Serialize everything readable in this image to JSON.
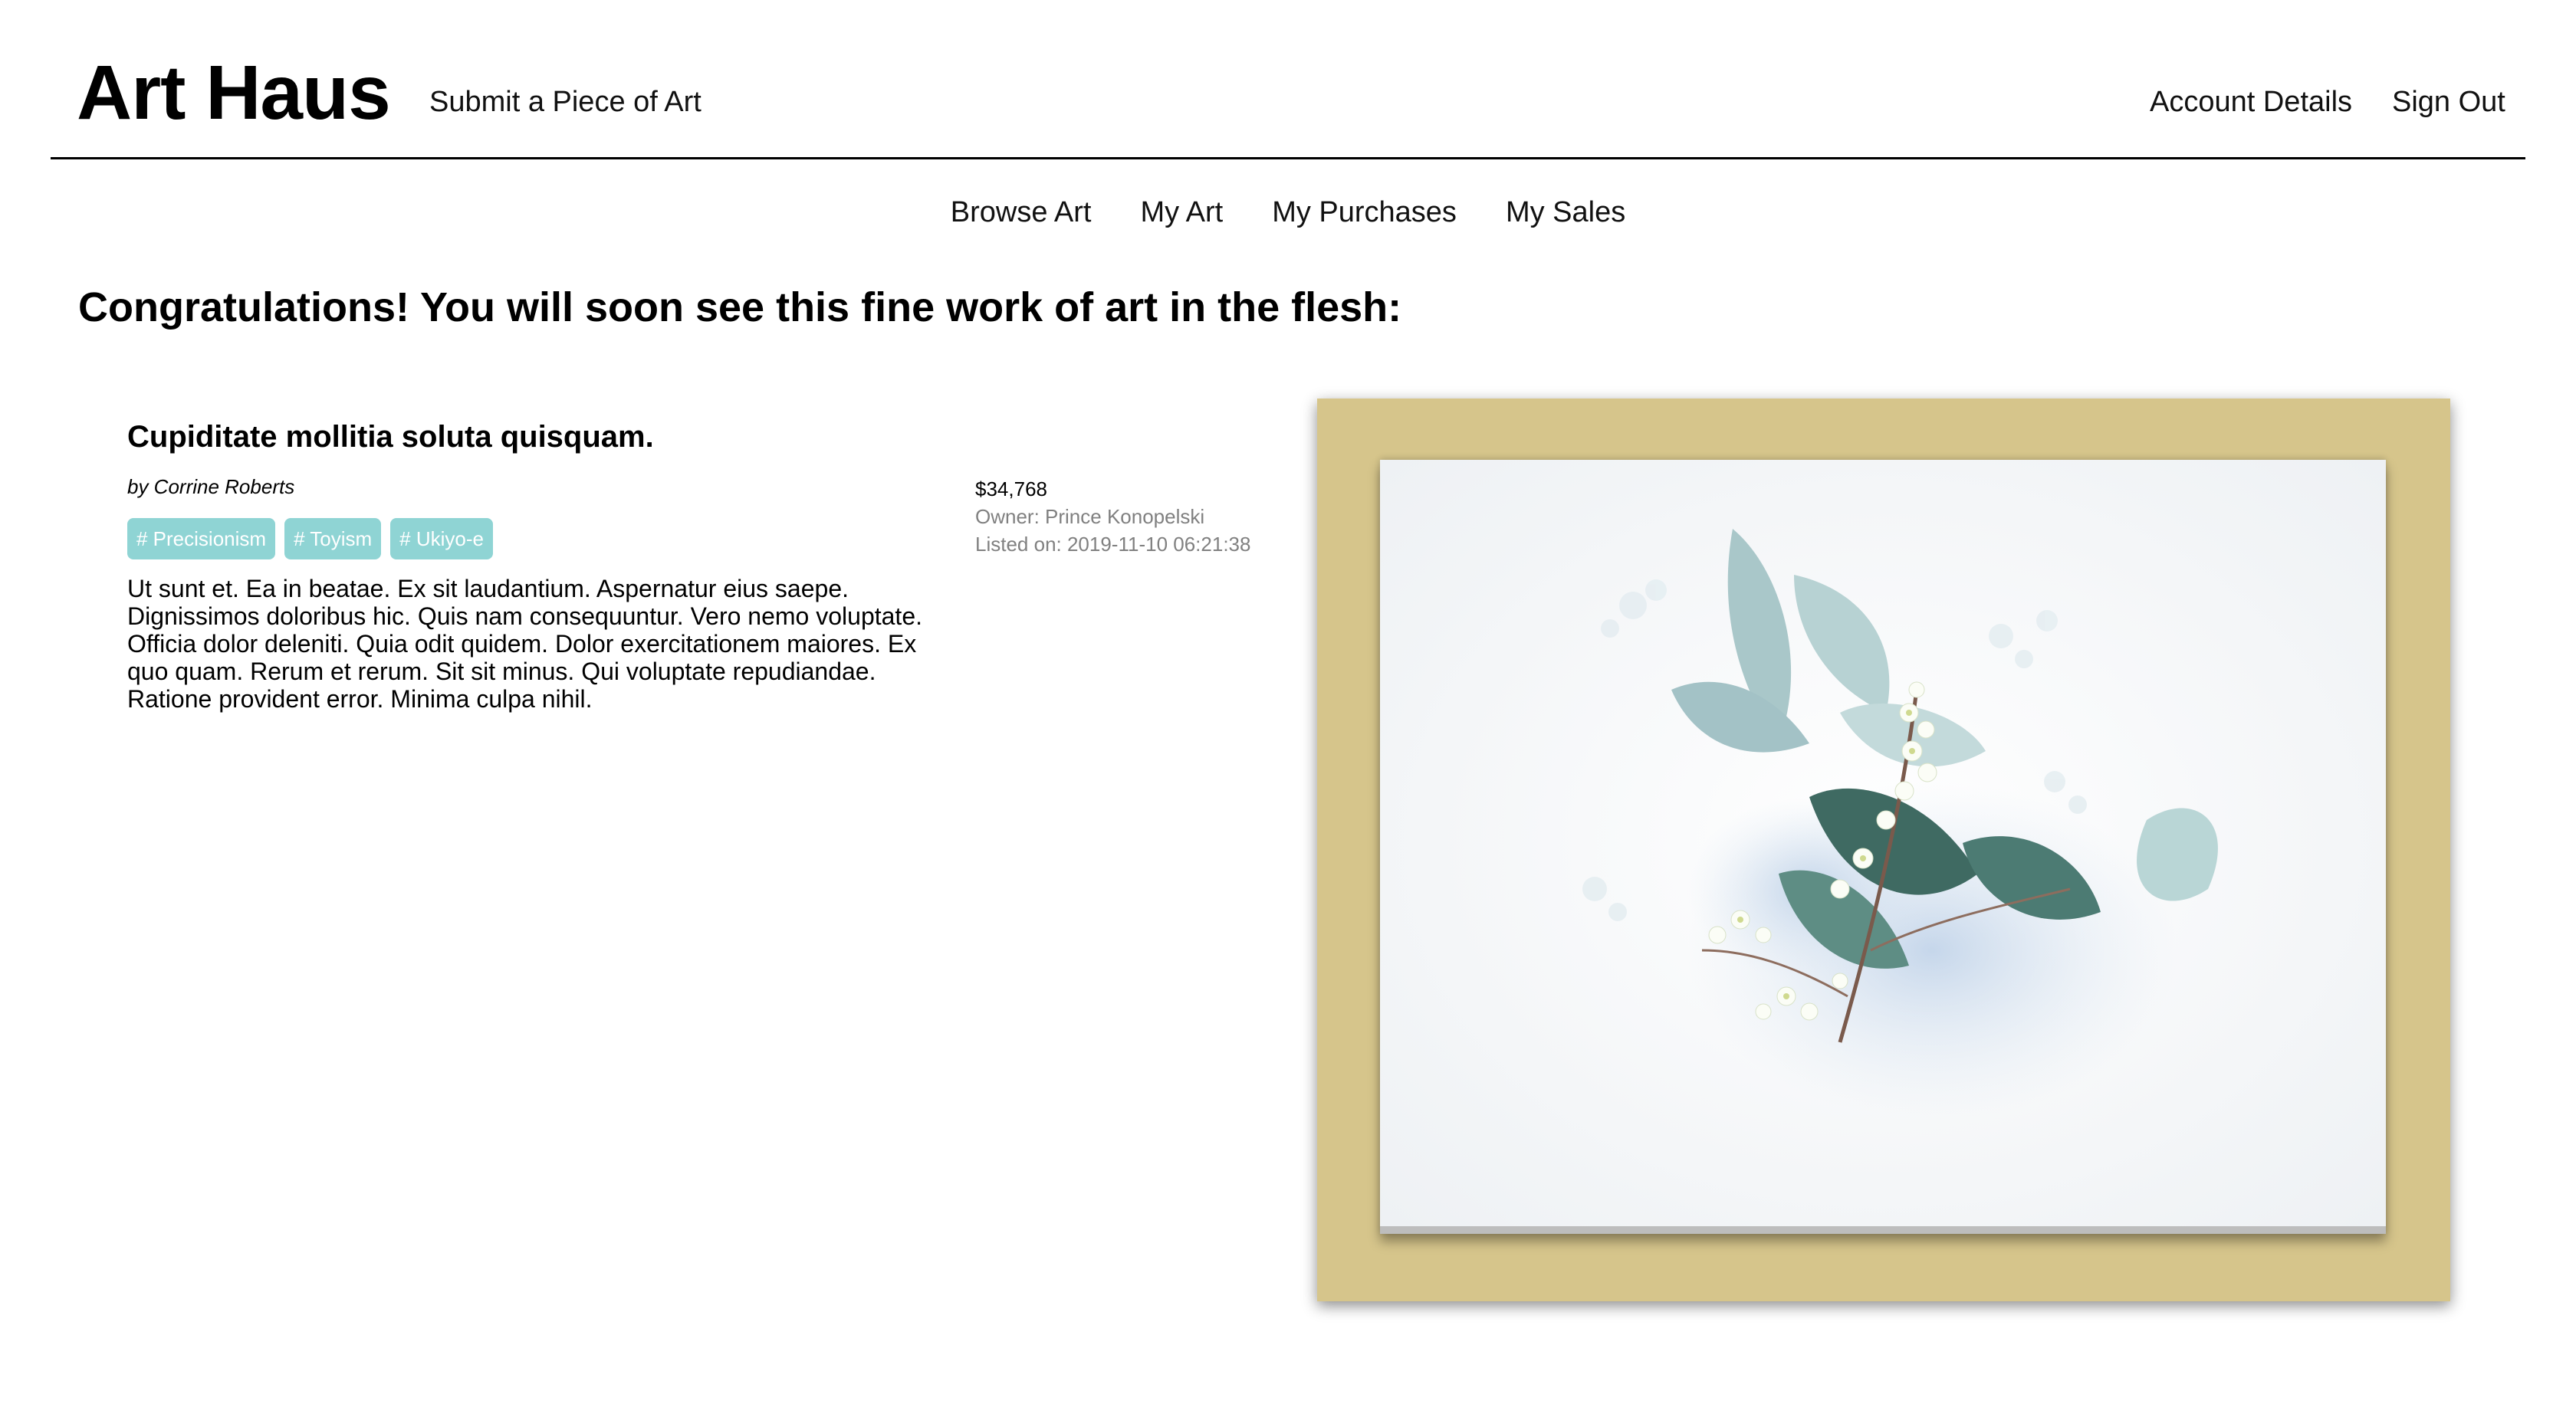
{
  "header": {
    "brand": "Art Haus",
    "submit_link": "Submit a Piece of Art",
    "account_link": "Account Details",
    "signout_link": "Sign Out"
  },
  "nav": {
    "items": [
      {
        "label": "Browse Art"
      },
      {
        "label": "My Art"
      },
      {
        "label": "My Purchases"
      },
      {
        "label": "My Sales"
      }
    ]
  },
  "page": {
    "heading": "Congratulations! You will soon see this fine work of art in the flesh:"
  },
  "artwork": {
    "title": "Cupiditate mollitia soluta quisquam.",
    "artist": "by Corrine Roberts",
    "tags": [
      "# Precisionism",
      "# Toyism",
      "# Ukiyo-e"
    ],
    "description": "Ut sunt et. Ea in beatae. Ex sit laudantium. Aspernatur eius saepe. Dignissimos doloribus hic. Quis nam consequuntur. Vero nemo voluptate. Officia dolor deleniti. Quia odit quidem. Dolor exercitationem maiores. Ex quo quam. Rerum et rerum. Sit sit minus. Qui voluptate repudiandae. Ratione provident error. Minima culpa nihil.",
    "price": "$34,768",
    "owner": "Owner: Prince Konopelski",
    "listed_on": "Listed on: 2019-11-10 06:21:38"
  },
  "colors": {
    "tag_background": "#8fd4d4",
    "frame_mat": "#d6c58b",
    "meta_gray": "#808080"
  }
}
